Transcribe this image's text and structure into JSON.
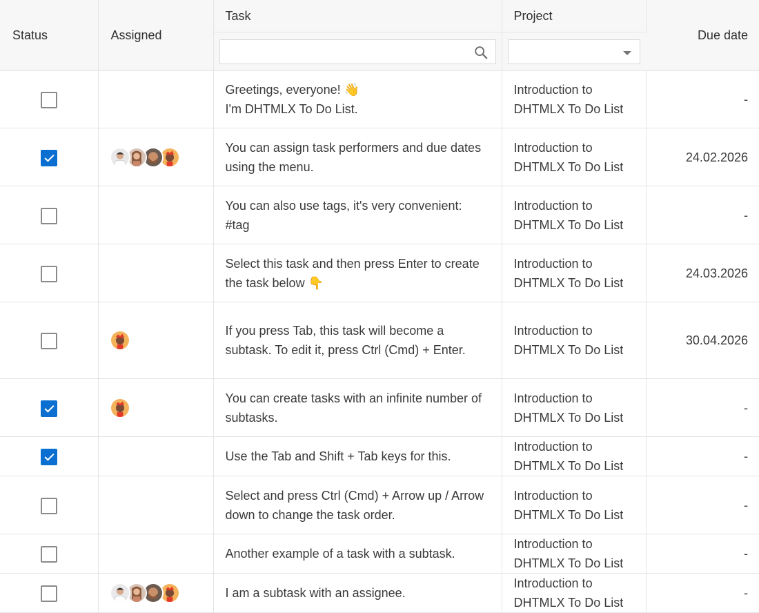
{
  "columns": {
    "status": "Status",
    "assigned": "Assigned",
    "task": "Task",
    "project": "Project",
    "due": "Due date"
  },
  "filters": {
    "task_search_value": "",
    "project_select_value": ""
  },
  "colors": {
    "accent": "#0a6fd0",
    "due_date": "#00b067"
  },
  "rows": [
    {
      "checked": false,
      "avatars": [],
      "task": "Greetings, everyone! 👋\nI'm DHTMLX To Do List.",
      "project": "Introduction to DHTMLX To Do List",
      "due": "-"
    },
    {
      "checked": true,
      "avatars": [
        "person-1",
        "person-2",
        "person-3",
        "person-4"
      ],
      "task": "You can assign task performers and due dates using the menu.",
      "project": "Introduction to DHTMLX To Do List",
      "due": "24.02.2026"
    },
    {
      "checked": false,
      "avatars": [],
      "task": "You can also use tags, it's very convenient: #tag",
      "project": "Introduction to DHTMLX To Do List",
      "due": "-"
    },
    {
      "checked": false,
      "avatars": [],
      "task": "Select this task and then press Enter to create the task below 👇",
      "project": "Introduction to DHTMLX To Do List",
      "due": "24.03.2026"
    },
    {
      "checked": false,
      "avatars": [
        "person-4"
      ],
      "task": "If you press Tab, this task will become a subtask. To edit it, press Ctrl (Cmd) + Enter.",
      "project": "Introduction to DHTMLX To Do List",
      "due": "30.04.2026"
    },
    {
      "checked": true,
      "avatars": [
        "person-4"
      ],
      "task": "You can create tasks with an infinite number of subtasks.",
      "project": "Introduction to DHTMLX To Do List",
      "due": "-"
    },
    {
      "checked": true,
      "avatars": [],
      "task": "Use the Tab and Shift + Tab keys for this.",
      "project": "Introduction to DHTMLX To Do List",
      "due": "-"
    },
    {
      "checked": false,
      "avatars": [],
      "task": "Select and press Ctrl (Cmd) + Arrow up / Arrow down to change the task order.",
      "project": "Introduction to DHTMLX To Do List",
      "due": "-"
    },
    {
      "checked": false,
      "avatars": [],
      "task": "Another example of a task with a subtask.",
      "project": "Introduction to DHTMLX To Do List",
      "due": "-"
    },
    {
      "checked": false,
      "avatars": [
        "person-1",
        "person-2",
        "person-3",
        "person-4"
      ],
      "task": "I am a subtask with an assignee.",
      "project": "Introduction to DHTMLX To Do List",
      "due": "-"
    }
  ]
}
